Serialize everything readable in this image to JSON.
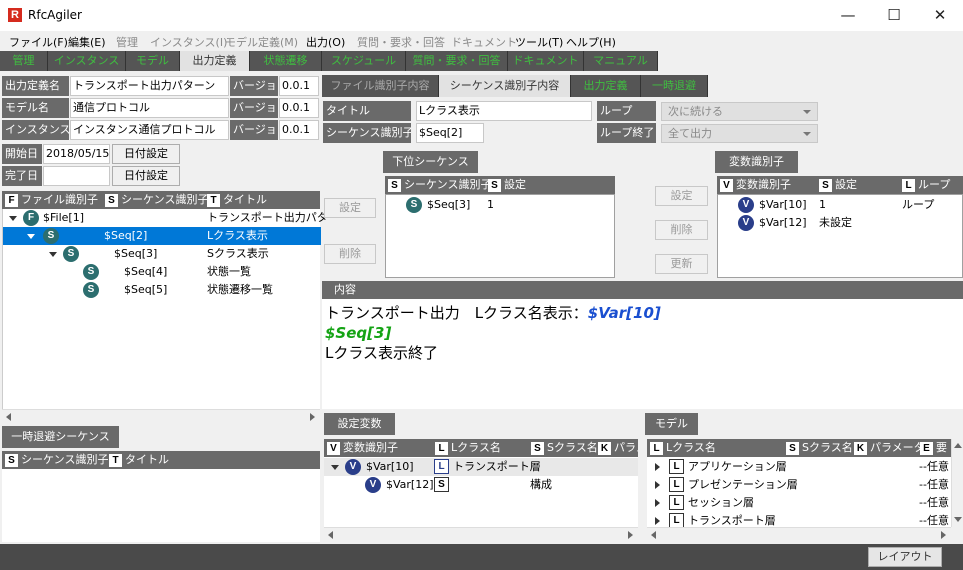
{
  "app": {
    "title": "RfcAgiler",
    "icon_letter": "R"
  },
  "window_controls": {
    "minimize": "—",
    "maximize": "☐",
    "close": "✕"
  },
  "menu": [
    {
      "label": "ファイル(F)",
      "enabled": true
    },
    {
      "label": "編集(E)",
      "enabled": true
    },
    {
      "label": "管理",
      "enabled": false
    },
    {
      "label": "インスタンス(I)",
      "enabled": false
    },
    {
      "label": "モデル定義(M)",
      "enabled": false
    },
    {
      "label": "出力(O)",
      "enabled": true
    },
    {
      "label": "質問・要求・回答",
      "enabled": false
    },
    {
      "label": "ドキュメント",
      "enabled": false
    },
    {
      "label": "ツール(T)",
      "enabled": true
    },
    {
      "label": "ヘルプ(H)",
      "enabled": true
    }
  ],
  "tabs": [
    "管理",
    "インスタンス",
    "モデル",
    "出力定義",
    "状態遷移",
    "スケジュール",
    "質問・要求・回答",
    "ドキュメント",
    "マニュアル"
  ],
  "active_tab": "出力定義",
  "left_form": {
    "output_def_label": "出力定義名",
    "output_def_value": "トランスポート出力パターン",
    "model_label": "モデル名",
    "model_value": "通信プロトコル",
    "instance_label": "インスタンス名",
    "instance_value": "インスタンス通信プロトコル",
    "version_label": "バージョン",
    "version1": "0.0.1",
    "version2": "0.0.1",
    "version3": "0.0.1",
    "start_label": "開始日",
    "start_value": "2018/05/15",
    "end_label": "完了日",
    "end_value": "",
    "date_btn": "日付設定"
  },
  "tree_header": {
    "f": "F",
    "file_id": "ファイル識別子",
    "s": "S",
    "seq_id": "シーケンス識別子",
    "t": "T",
    "title": "タイトル"
  },
  "tree": [
    {
      "badge": "F",
      "id": "$File[1]",
      "title": "トランスポート出力パター"
    },
    {
      "badge": "S",
      "id": "$Seq[2]",
      "title": "Lクラス表示"
    },
    {
      "badge": "S",
      "id": "$Seq[3]",
      "title": "Sクラス表示"
    },
    {
      "badge": "S",
      "id": "$Seq[4]",
      "title": "状態一覧"
    },
    {
      "badge": "S",
      "id": "$Seq[5]",
      "title": "状態遷移一覧"
    }
  ],
  "temp_seq": {
    "tab": "一時退避シーケンス",
    "s": "S",
    "seq_id": "シーケンス識別子",
    "t": "T",
    "title": "タイトル"
  },
  "right_tabs": [
    "ファイル識別子内容",
    "シーケンス識別子内容",
    "出力定義",
    "一時退避"
  ],
  "right_active_tab": "シーケンス識別子内容",
  "seq_form": {
    "title_label": "タイトル",
    "title_value": "Lクラス表示",
    "seqid_label": "シーケンス識別子",
    "seqid_value": "$Seq[2]",
    "loop_label": "ループ",
    "loop_value": "次に続ける",
    "loopend_label": "ループ終了",
    "loopend_value": "全て出力"
  },
  "sub_seq": {
    "tab": "下位シーケンス",
    "s": "S",
    "col1": "シーケンス識別子",
    "s2": "S",
    "col2": "設定",
    "rows": [
      {
        "badge": "S",
        "id": "$Seq[3]",
        "setting": "1"
      }
    ]
  },
  "mid_buttons": {
    "set": "設定",
    "delete": "削除"
  },
  "var_buttons": {
    "set": "設定",
    "delete": "削除",
    "update": "更新"
  },
  "var_id": {
    "tab": "変数識別子",
    "v": "V",
    "col1": "変数識別子",
    "s": "S",
    "col2": "設定",
    "l": "L",
    "col3": "ループ",
    "rows": [
      {
        "badge": "V",
        "id": "$Var[10]",
        "setting": "1",
        "loop": "ループ"
      },
      {
        "badge": "V",
        "id": "$Var[12]",
        "setting": "未設定",
        "loop": ""
      }
    ]
  },
  "content": {
    "header": "内容",
    "line1_text": "トランスポート出力　Lクラス名表示：",
    "line1_var": "$Var[10]",
    "line2_seq": "$Seq[3]",
    "line3_text": "Lクラス表示終了"
  },
  "setting_vars": {
    "tab": "設定変数",
    "v": "V",
    "col1": "変数識別子",
    "l": "L",
    "col2": "Lクラス名",
    "s": "S",
    "col3": "Sクラス名",
    "k": "K",
    "col4": "パラメ",
    "rows": [
      {
        "badge": "V",
        "id": "$Var[10]",
        "lbadge": "L",
        "lclass": "トランスポート層",
        "sclass": ""
      },
      {
        "badge": "V",
        "id": "$Var[12]",
        "lbadge": "S",
        "lclass": "",
        "sclass": "構成"
      }
    ]
  },
  "model": {
    "tab": "モデル",
    "l": "L",
    "col1": "Lクラス名",
    "s": "S",
    "col2": "Sクラス名",
    "k": "K",
    "col3": "パラメータ",
    "e": "E",
    "col4": "要",
    "rows": [
      {
        "badge": "L",
        "name": "アプリケーション層",
        "param": "--任意"
      },
      {
        "badge": "L",
        "name": "プレゼンテーション層",
        "param": "--任意"
      },
      {
        "badge": "L",
        "name": "セッション層",
        "param": "--任意"
      },
      {
        "badge": "L",
        "name": "トランスポート層",
        "param": "--任意"
      }
    ]
  },
  "status": {
    "layout_btn": "レイアウト"
  },
  "colors": {
    "tab_text": "#3fbf40",
    "header_bg": "#6a6a6a",
    "selection": "#0078d7",
    "var_blue": "#1a4fd0",
    "seq_green": "#14a314"
  }
}
